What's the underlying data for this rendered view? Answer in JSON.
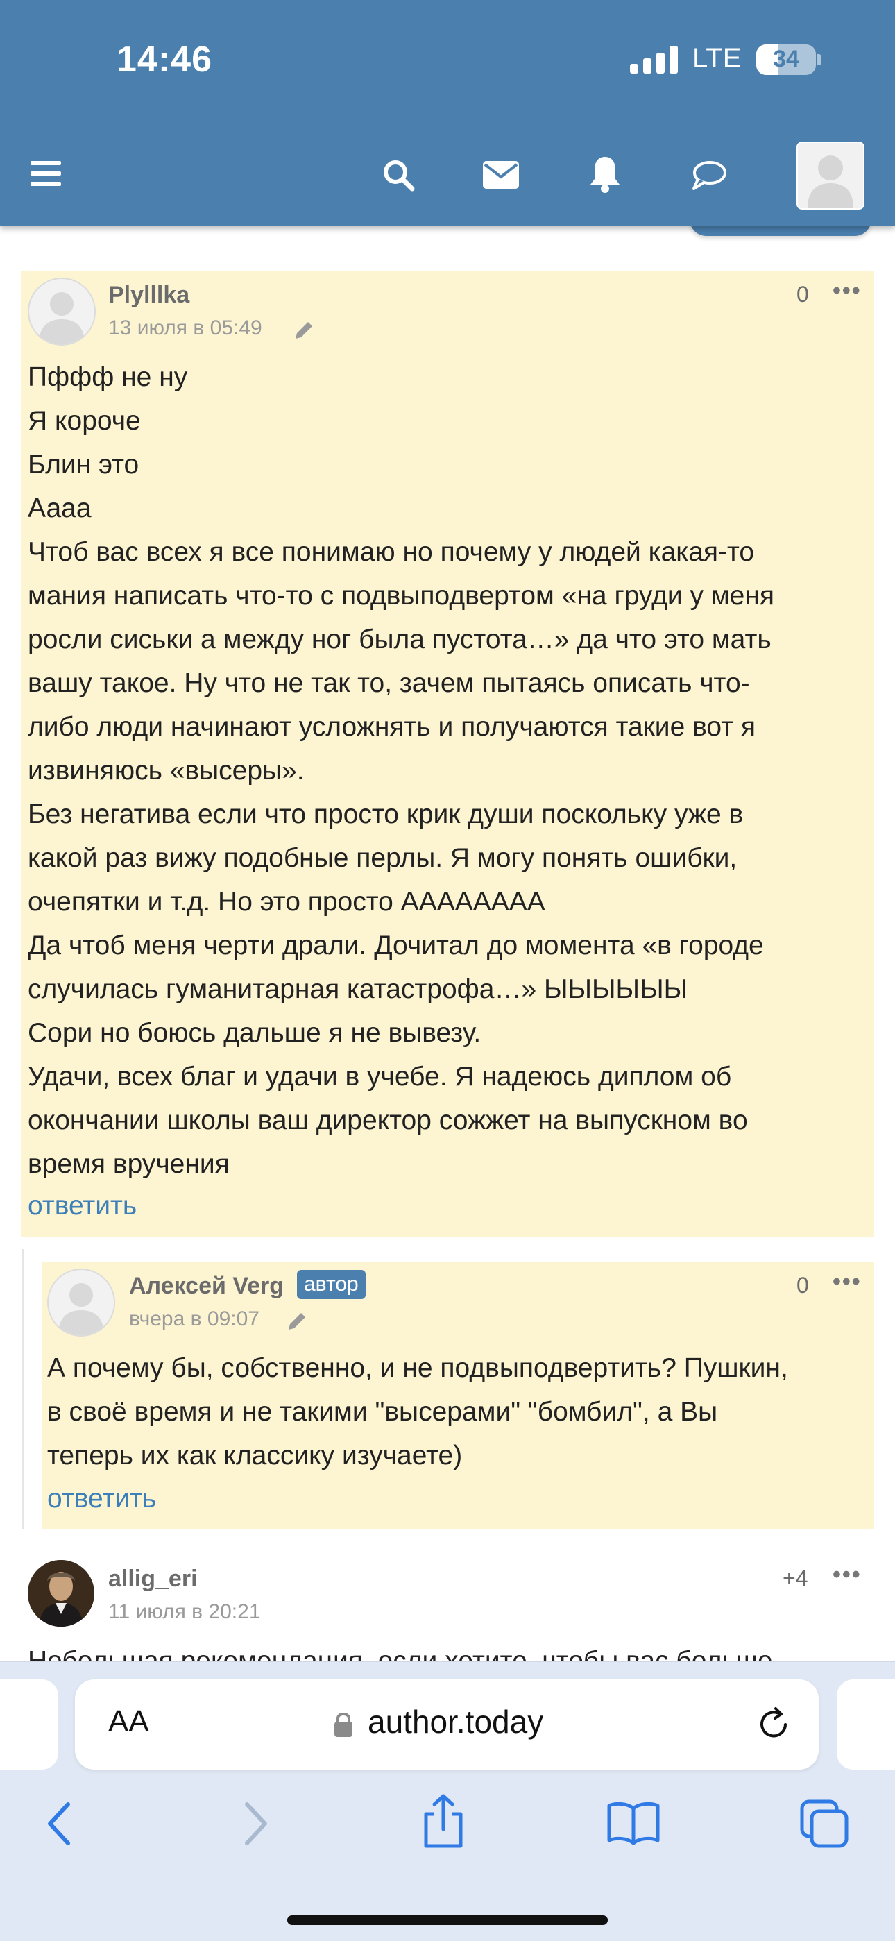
{
  "status_bar": {
    "time": "14:46",
    "network": "LTE",
    "battery": "34"
  },
  "header": {
    "menu_icon": "hamburger-icon",
    "search_icon": "search-icon",
    "mail_icon": "envelope-icon",
    "notifications_icon": "bell-icon",
    "chat_icon": "speech-bubble-icon",
    "avatar_icon": "user-avatar-icon"
  },
  "comments": [
    {
      "author": "Plylllka",
      "date": "13 июля в 05:49",
      "score": "0",
      "more": "•••",
      "lines": [
        "Пффф не ну",
        "Я короче",
        "Блин это",
        "Аааа",
        "Чтоб вас всех я все понимаю но почему у людей какая-то",
        "мания написать что-то с подвыподвертом «на груди у меня",
        "росли сиськи а между ног была пустота…» да что это мать",
        "вашу такое. Ну что не так то, зачем пытаясь описать что-",
        "либо люди начинают усложнять и получаются такие вот я",
        "извиняюсь «высеры».",
        "Без негатива если что просто крик души поскольку уже в",
        "какой раз вижу подобные перлы. Я могу понять ошибки,",
        "очепятки и т.д. Но это просто АААААААА",
        "Да чтоб меня черти драли. Дочитал до момента «в городе",
        "случилась гуманитарная катастрофа…» ЫЫЫЫЫЫ",
        "Сори но боюсь дальше я не вывезу.",
        "Удачи, всех благ и удачи в учебе. Я надеюсь диплом об",
        "окончании школы ваш директор сожжет на выпускном во",
        "время вручения"
      ],
      "reply_label": "ответить"
    },
    {
      "author": "Алексей Verg",
      "badge": "автор",
      "date": "вчера в 09:07",
      "score": "0",
      "more": "•••",
      "lines": [
        "А почему бы, собственно, и не подвыподвертить? Пушкин,",
        "в своё время и не такими \"высерами\" \"бомбил\", а Вы",
        "теперь их как классику изучаете)"
      ],
      "reply_label": "ответить"
    },
    {
      "author": "allig_eri",
      "date": "11 июля в 20:21",
      "score": "+4",
      "more": "•••",
      "partial_line": "Небольшая рекомендация, если хотите, чтобы вас больше"
    }
  ],
  "browser": {
    "text_size_label": "AA",
    "url": "author.today",
    "reload_icon": "reload-icon",
    "back_icon": "back-chevron-icon",
    "forward_icon": "forward-chevron-icon",
    "share_icon": "share-icon",
    "bookmarks_icon": "open-book-icon",
    "tabs_icon": "tabs-icon"
  }
}
